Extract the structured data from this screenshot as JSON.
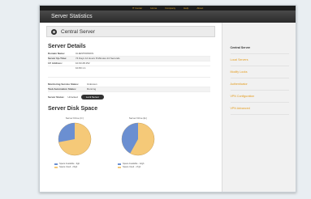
{
  "topnav": [
    "IT Center",
    "Home",
    "Company",
    "Help",
    "About"
  ],
  "window": {
    "title": "Server Statistics"
  },
  "server": {
    "name": "Central Server"
  },
  "details": {
    "heading": "Server Details",
    "rows": [
      {
        "label": "Domain Name:",
        "value": "CLIENTRONIKS"
      },
      {
        "label": "Server Up-Time:",
        "value": "74 Days 12 Hours 8 Minutes 24 Seconds"
      },
      {
        "label": "I.P. Address:",
        "value": "10.93.28.152"
      },
      {
        "label": "",
        "value": "10.83.1.1"
      }
    ],
    "monitoring_label": "Monitoring Service Status:",
    "monitoring_value": "Unknown",
    "task_label": "Task Automation Status:",
    "task_value": "Running",
    "status_label": "Server Status:",
    "status_value": "Unlocked",
    "lock_button": "Lock Server"
  },
  "disk_space": {
    "heading": "Server Disk Space",
    "disks": [
      {
        "name": "Server Drive (C:)",
        "used_fraction": 0.72,
        "available": "Space Available - 9gb",
        "used": "Space Used - 23gb"
      },
      {
        "name": "Server Drive (E:)",
        "used_fraction": 0.58,
        "available": "Space Available - 12gb",
        "used": "Space Used - 17gb"
      }
    ],
    "colors": {
      "available": "#6b8fd1",
      "used": "#f5c978"
    }
  },
  "sidebar": {
    "items": [
      {
        "label": "Central Server"
      },
      {
        "label": "Local Servers"
      },
      {
        "label": "Modify Locks"
      },
      {
        "label": "Authenticator"
      },
      {
        "label": "VPN Configuration"
      },
      {
        "label": "VPN Advanced"
      }
    ]
  }
}
